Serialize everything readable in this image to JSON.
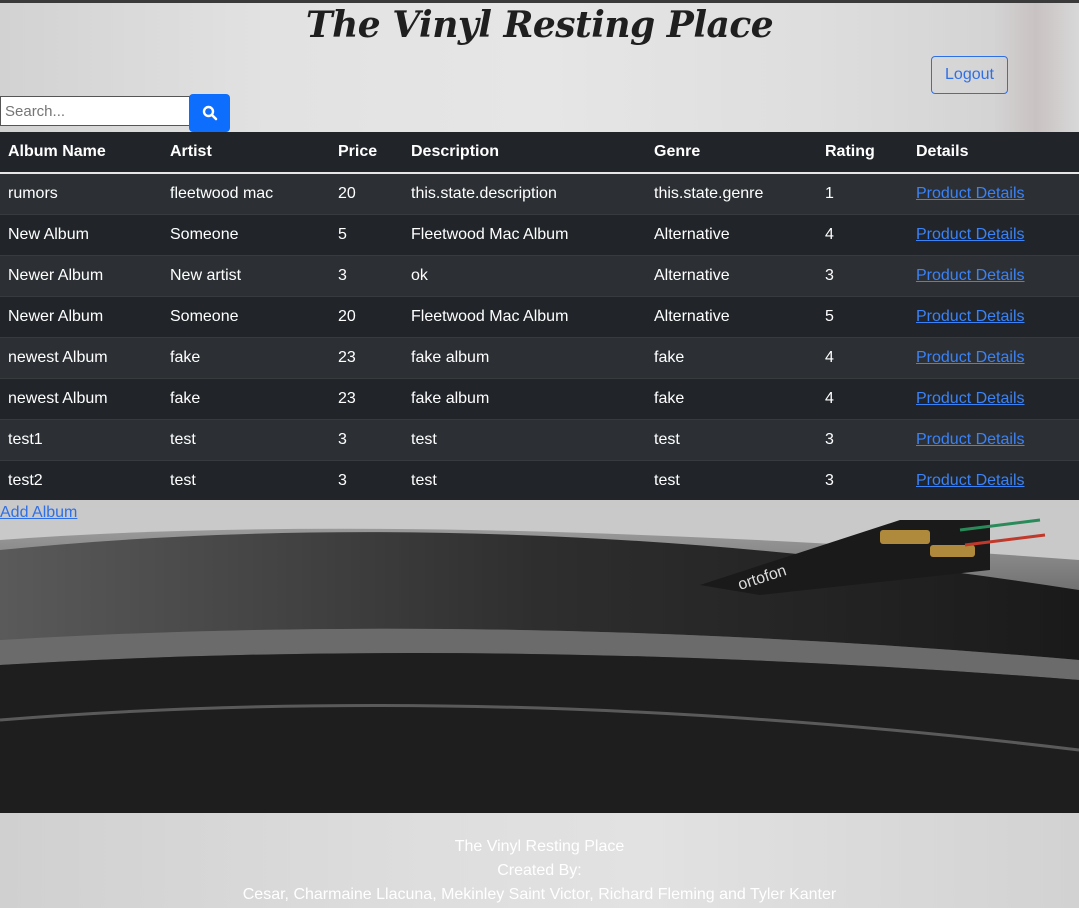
{
  "header": {
    "title": "The Vinyl Resting Place",
    "logout_label": "Logout"
  },
  "search": {
    "placeholder": "Search...",
    "button_icon": "search-icon"
  },
  "table": {
    "columns": [
      "Album Name",
      "Artist",
      "Price",
      "Description",
      "Genre",
      "Rating",
      "Details"
    ],
    "rows": [
      {
        "album": "rumors",
        "artist": "fleetwood mac",
        "price": "20",
        "description": "this.state.description",
        "genre": "this.state.genre",
        "rating": "1",
        "details": "Product Details"
      },
      {
        "album": "New Album",
        "artist": "Someone",
        "price": "5",
        "description": "Fleetwood Mac Album",
        "genre": "Alternative",
        "rating": "4",
        "details": "Product Details"
      },
      {
        "album": "Newer Album",
        "artist": "New artist",
        "price": "3",
        "description": "ok",
        "genre": "Alternative",
        "rating": "3",
        "details": "Product Details"
      },
      {
        "album": "Newer Album",
        "artist": "Someone",
        "price": "20",
        "description": "Fleetwood Mac Album",
        "genre": "Alternative",
        "rating": "5",
        "details": "Product Details"
      },
      {
        "album": "newest Album",
        "artist": "fake",
        "price": "23",
        "description": "fake album",
        "genre": "fake",
        "rating": "4",
        "details": "Product Details"
      },
      {
        "album": "newest Album",
        "artist": "fake",
        "price": "23",
        "description": "fake album",
        "genre": "fake",
        "rating": "4",
        "details": "Product Details"
      },
      {
        "album": "test1",
        "artist": "test",
        "price": "3",
        "description": "test",
        "genre": "test",
        "rating": "3",
        "details": "Product Details"
      },
      {
        "album": "test2",
        "artist": "test",
        "price": "3",
        "description": "test",
        "genre": "test",
        "rating": "3",
        "details": "Product Details"
      }
    ]
  },
  "add_album_label": "Add Album",
  "photo": {
    "cartridge_brand": "ortofon"
  },
  "footer": {
    "line1": "The Vinyl Resting Place",
    "line2": "Created By:",
    "line3": "Cesar, Charmaine Llacuna, Mekinley Saint Victor, Richard Fleming and Tyler Kanter"
  },
  "colors": {
    "accent": "#0d6efd",
    "link": "#3b82f6",
    "table_bg": "#212529",
    "table_stripe": "#2c3034"
  }
}
